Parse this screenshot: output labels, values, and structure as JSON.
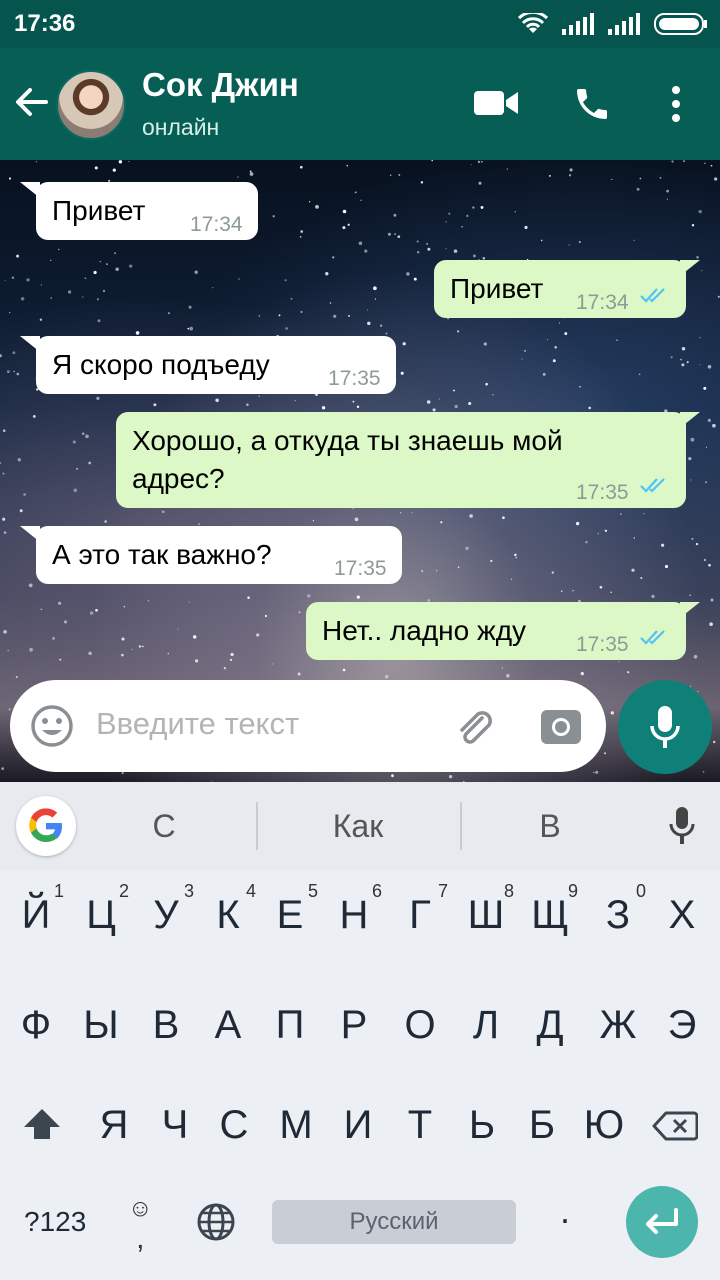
{
  "status_bar": {
    "time": "17:36"
  },
  "header": {
    "contact_name": "Сок Джин",
    "contact_status": "онлайн"
  },
  "messages": [
    {
      "direction": "in",
      "text": "Привет",
      "time": "17:34"
    },
    {
      "direction": "out",
      "text": "Привет",
      "time": "17:34",
      "read": true
    },
    {
      "direction": "in",
      "text": "Я скоро подъеду",
      "time": "17:35"
    },
    {
      "direction": "out",
      "text": "Хорошо, а откуда ты знаешь мой адрес?",
      "time": "17:35",
      "read": true
    },
    {
      "direction": "in",
      "text": "А это так важно?",
      "time": "17:35"
    },
    {
      "direction": "out",
      "text": "Нет.. ладно жду",
      "time": "17:35",
      "read": true
    }
  ],
  "input": {
    "placeholder": "Введите текст"
  },
  "keyboard": {
    "suggestions": [
      "С",
      "Как",
      "В"
    ],
    "row1": [
      "Й",
      "Ц",
      "У",
      "К",
      "Е",
      "Н",
      "Г",
      "Ш",
      "Щ",
      "З",
      "Х"
    ],
    "row1_hints": [
      "1",
      "2",
      "3",
      "4",
      "5",
      "6",
      "7",
      "8",
      "9",
      "0",
      ""
    ],
    "row2": [
      "Ф",
      "Ы",
      "В",
      "А",
      "П",
      "Р",
      "О",
      "Л",
      "Д",
      "Ж",
      "Э"
    ],
    "row3": [
      "Я",
      "Ч",
      "С",
      "М",
      "И",
      "Т",
      "Ь",
      "Б",
      "Ю"
    ],
    "symbols_label": "?123",
    "emoji_label": "☺",
    "comma_label": ",",
    "space_label": "Русский",
    "period_label": "."
  },
  "colors": {
    "header": "#075e54",
    "status_bar": "#05544d",
    "outgoing_bubble": "#dcf8c6",
    "incoming_bubble": "#ffffff",
    "read_ticks": "#4fc3f7",
    "mic_button": "#0e8078",
    "enter_key": "#4db6ac"
  },
  "icons": [
    "back-arrow-icon",
    "video-call-icon",
    "phone-icon",
    "more-vert-icon",
    "emoji-icon",
    "paperclip-icon",
    "camera-icon",
    "mic-icon",
    "google-icon",
    "shift-icon",
    "backspace-icon",
    "globe-icon",
    "enter-icon"
  ]
}
